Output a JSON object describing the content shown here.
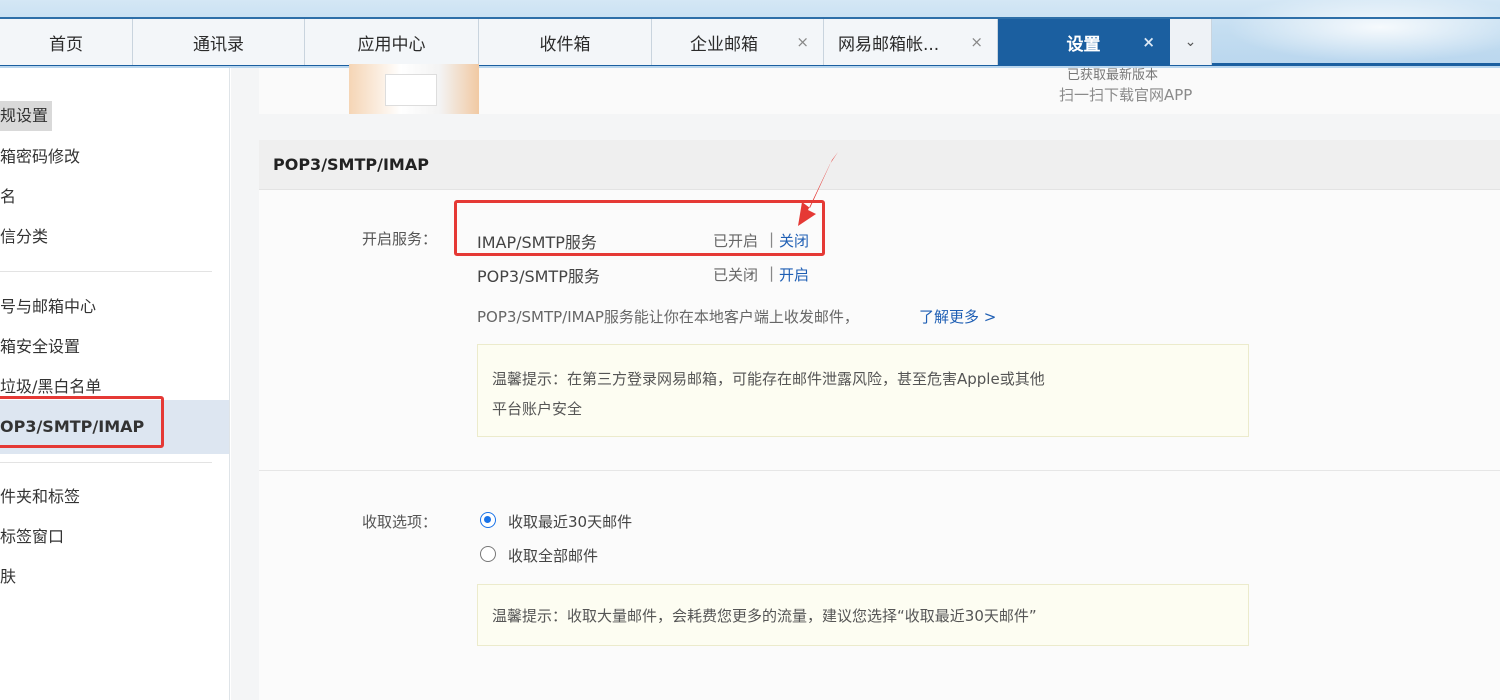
{
  "tabs": [
    {
      "label": "首页",
      "closable": false,
      "active": false
    },
    {
      "label": "通讯录",
      "closable": false,
      "active": false
    },
    {
      "label": "应用中心",
      "closable": false,
      "active": false
    },
    {
      "label": "收件箱",
      "closable": false,
      "active": false
    },
    {
      "label": "企业邮箱",
      "closable": true,
      "active": false
    },
    {
      "label": "网易邮箱帐...",
      "closable": true,
      "active": false
    },
    {
      "label": "设置",
      "closable": true,
      "active": true
    }
  ],
  "tab_close_glyph": "×",
  "tab_more_glyph": "⌄",
  "sidebar": {
    "items": [
      {
        "label": "规设置"
      },
      {
        "label": "箱密码修改"
      },
      {
        "label": "名"
      },
      {
        "label": "信分类"
      },
      {
        "label": "号与邮箱中心"
      },
      {
        "label": "箱安全设置"
      },
      {
        "label": "垃圾/黑白名单"
      },
      {
        "label": "OP3/SMTP/IMAP"
      },
      {
        "label": "件夹和标签"
      },
      {
        "label": "标签窗口"
      },
      {
        "label": "肤"
      }
    ]
  },
  "banner": {
    "line1": "已获取最新版本",
    "line2": "扫一扫下载官网APP"
  },
  "panel": {
    "title": "POP3/SMTP/IMAP",
    "service_label": "开启服务：",
    "services": [
      {
        "name": "IMAP/SMTP服务",
        "status": "已开启",
        "separator": "|",
        "action": "关闭"
      },
      {
        "name": "POP3/SMTP服务",
        "status": "已关闭",
        "separator": "|",
        "action": "开启"
      }
    ],
    "description": "POP3/SMTP/IMAP服务能让你在本地客户端上收发邮件，",
    "learn_more": "了解更多 >",
    "tip1": {
      "line1": "温馨提示：在第三方登录网易邮箱，可能存在邮件泄露风险，甚至危害Apple或其他",
      "line2": "平台账户安全"
    },
    "fetch_label": "收取选项：",
    "fetch_options": [
      {
        "label": "收取最近30天邮件",
        "selected": true
      },
      {
        "label": "收取全部邮件",
        "selected": false
      }
    ],
    "tip2": "温馨提示：收取大量邮件，会耗费您更多的流量，建议您选择“收取最近30天邮件”"
  },
  "colors": {
    "accent": "#1b5fa0",
    "link": "#1f5fb4",
    "highlight_red": "#e53935",
    "radio_selected": "#1a73e8"
  }
}
